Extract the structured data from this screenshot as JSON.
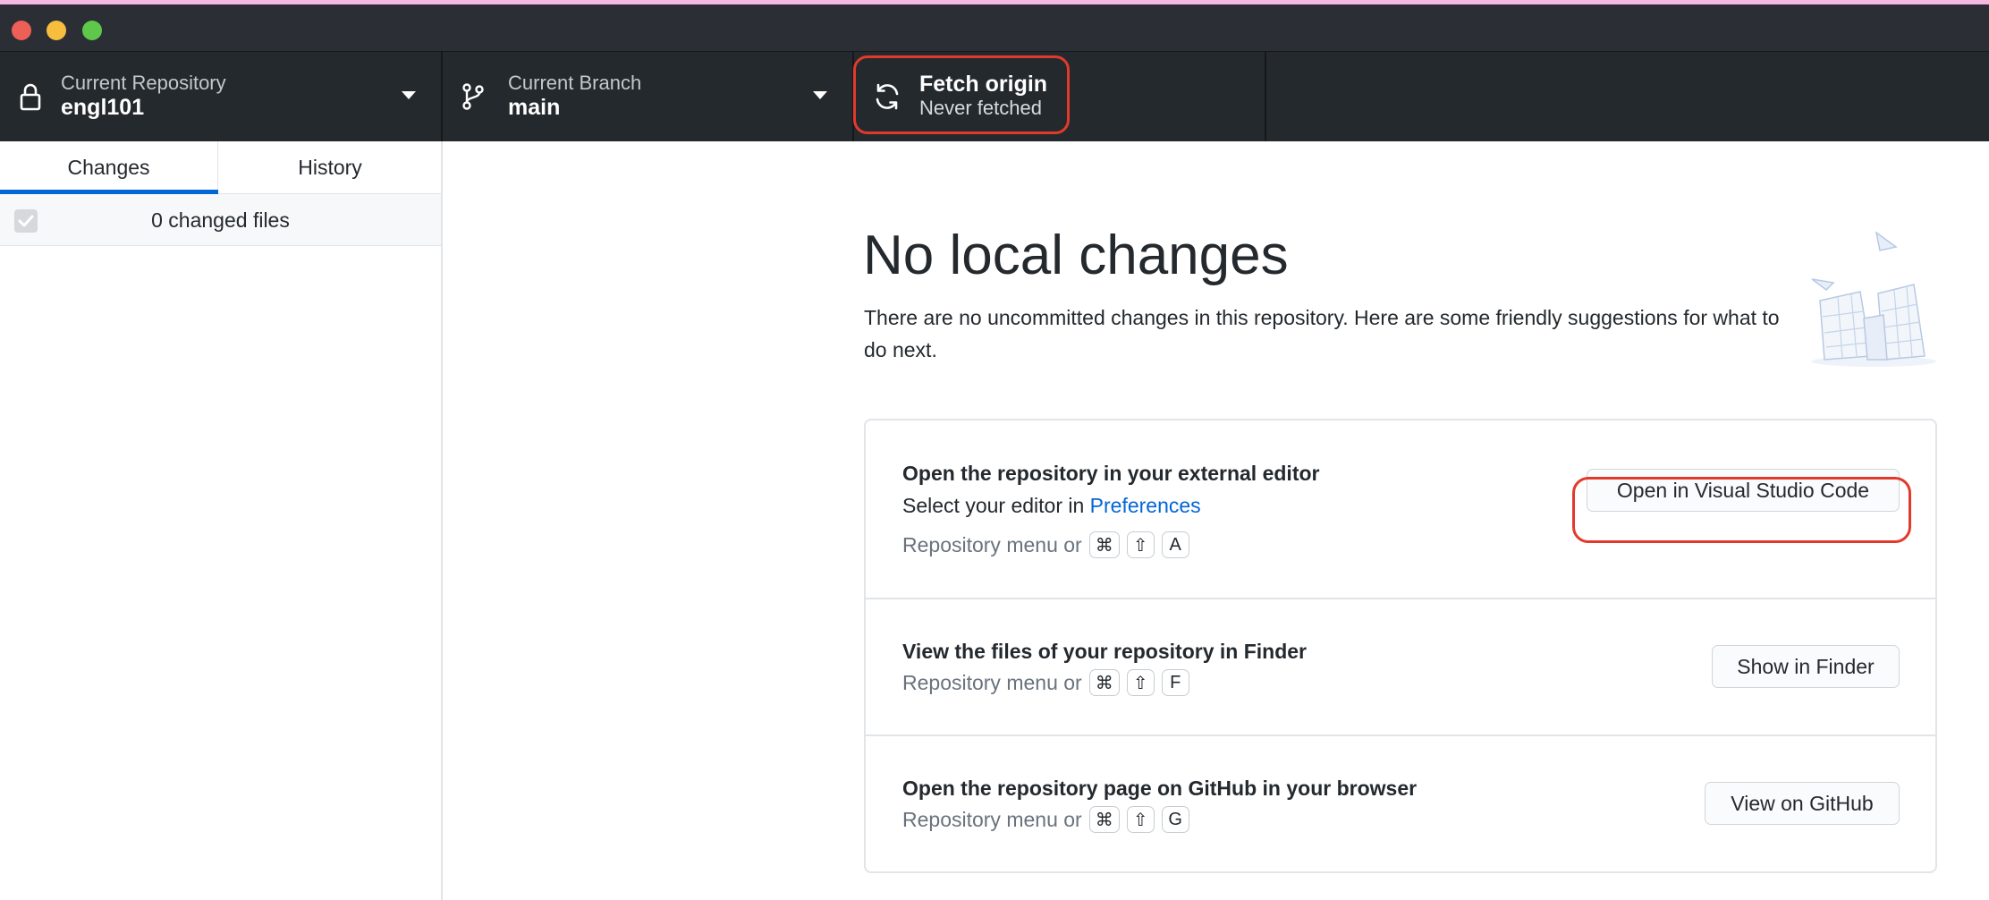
{
  "window": {
    "controls": [
      "close",
      "minimize",
      "maximize"
    ]
  },
  "toolbar": {
    "repository": {
      "label": "Current Repository",
      "value": "engl101",
      "icon": "lock-icon"
    },
    "branch": {
      "label": "Current Branch",
      "value": "main",
      "icon": "git-branch-icon"
    },
    "fetch": {
      "title": "Fetch origin",
      "subtitle": "Never fetched",
      "icon": "sync-icon"
    }
  },
  "sidebar": {
    "tabs": [
      {
        "label": "Changes",
        "selected": true
      },
      {
        "label": "History",
        "selected": false
      }
    ],
    "changed_files_label": "0 changed files",
    "select_all_checked": true
  },
  "main": {
    "title": "No local changes",
    "description": "There are no uncommitted changes in this repository. Here are some friendly suggestions for what to do next.",
    "suggestions": [
      {
        "title": "Open the repository in your external editor",
        "line_prefix": "Select your editor in ",
        "line_link": "Preferences",
        "hint": "Repository menu or",
        "keys": [
          "⌘",
          "⇧",
          "A"
        ],
        "button": "Open in Visual Studio Code"
      },
      {
        "title": "View the files of your repository in Finder",
        "hint": "Repository menu or",
        "keys": [
          "⌘",
          "⇧",
          "F"
        ],
        "button": "Show in Finder"
      },
      {
        "title": "Open the repository page on GitHub in your browser",
        "hint": "Repository menu or",
        "keys": [
          "⌘",
          "⇧",
          "G"
        ],
        "button": "View on GitHub"
      }
    ]
  },
  "colors": {
    "toolbar_bg": "#24292e",
    "accent": "#0366d6",
    "highlight": "#e23a2a"
  }
}
